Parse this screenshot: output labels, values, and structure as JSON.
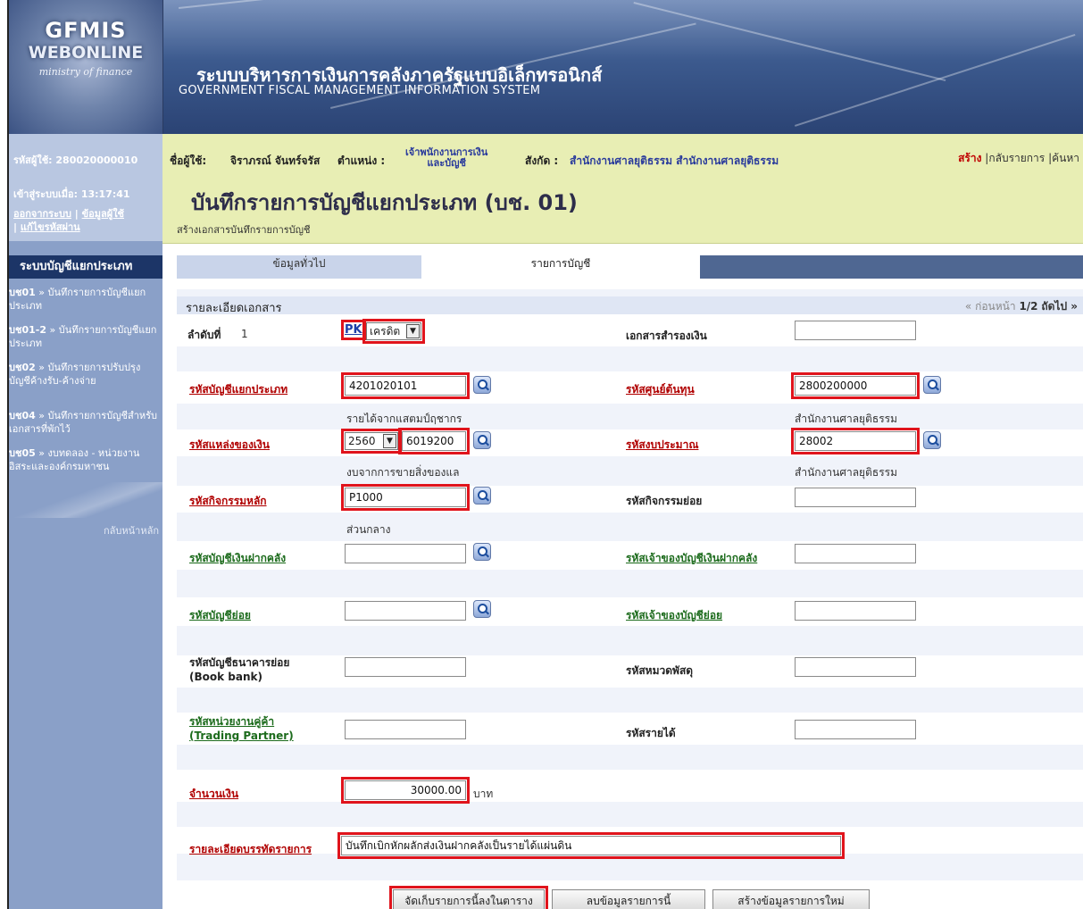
{
  "logo": {
    "line1": "GFMIS",
    "line2": "WEBONLINE",
    "line3": "ministry of finance"
  },
  "system": {
    "title_th": "ระบบบริหารการเงินการคลังภาครัฐแบบอิเล็กทรอนิกส์",
    "title_en": "GOVERNMENT FISCAL MANAGEMENT INFORMATION SYSTEM"
  },
  "sidebar": {
    "user_id_label": "รหัสผู้ใช้:",
    "user_id": "280020000010",
    "login_label": "เข้าสู่ระบบเมื่อ:",
    "login_time": "13:17:41",
    "links": [
      "ออกจากระบบ",
      "ข้อมูลผู้ใช้",
      "แก้ไขรหัสผ่าน"
    ],
    "section_title": "ระบบบัญชีแยกประเภท",
    "items": [
      {
        "code": "บช01",
        "text": "บันทึกรายการบัญชีแยกประเภท"
      },
      {
        "code": "บช01-2",
        "text": "บันทึกรายการบัญชีแยกประเภท"
      },
      {
        "code": "บช02",
        "text": "บันทึกรายการปรับปรุงบัญชีค้างรับ-ค้างจ่าย"
      },
      {
        "code": "บช04",
        "text": "บันทึกรายการบัญชีสำหรับเอกสารที่พักไว้"
      },
      {
        "code": "บช05",
        "text": "งบทดลอง - หน่วยงานอิสระและองค์กรมหาชน"
      }
    ],
    "back": "กลับหน้าหลัก"
  },
  "userbar": {
    "user_label": "ชื่อผู้ใช้:",
    "user_name": "จิราภรณ์ จันทร์จรัส",
    "position_label": "ตำแหน่ง :",
    "position_l1": "เจ้าพนักงานการเงิน",
    "position_l2": "และบัญชี",
    "affil_label": "สังกัด :",
    "affil": "สำนักงานศาลยุติธรรม สำนักงานศาลยุติธรรม",
    "actions": {
      "create": "สร้าง",
      "back": "กลับรายการ",
      "search": "ค้นหา"
    }
  },
  "page": {
    "title": "บันทึกรายการบัญชีแยกประเภท (บช. 01)",
    "subtitle": "สร้างเอกสารบันทึกรายการบัญชี"
  },
  "tabs": [
    "ข้อมูลทั่วไป",
    "รายการบัญชี"
  ],
  "form": {
    "section_title": "รายละเอียดเอกสาร",
    "pager": {
      "prev": "« ก่อนหน้า",
      "page": "1/2",
      "next": "ถัดไป »"
    },
    "seq_label": "ลำดับที่",
    "seq": "1",
    "pk": "PK",
    "posting_type": "เครดิต",
    "reserve_doc_label": "เอกสารสำรองเงิน",
    "gl_label": "รหัสบัญชีแยกประเภท",
    "gl": "4201020101",
    "gl_desc": "รายได้จากแสตมป์ฤชากร",
    "cost_center_label": "รหัสศูนย์ต้นทุน",
    "cost_center": "2800200000",
    "cost_center_desc": "สำนักงานศาลยุติธรรม",
    "fund_label": "รหัสแหล่งของเงิน",
    "fund_year": "2560",
    "fund": "6019200",
    "fund_desc": "งบจากการขายสิ่งของแล",
    "budget_label": "รหัสงบประมาณ",
    "budget": "28002",
    "budget_desc": "สำนักงานศาลยุติธรรม",
    "activity_label": "รหัสกิจกรรมหลัก",
    "activity": "P1000",
    "activity_desc": "ส่วนกลาง",
    "sub_activity_label": "รหัสกิจกรรมย่อย",
    "deposit_acct_label": "รหัสบัญชีเงินฝากคลัง",
    "deposit_owner_label": "รหัสเจ้าของบัญชีเงินฝากคลัง",
    "sub_acct_label": "รหัสบัญชีย่อย",
    "sub_acct_owner_label": "รหัสเจ้าของบัญชีย่อย",
    "bank_label_1": "รหัสบัญชีธนาคารย่อย",
    "bank_label_2": "(Book bank)",
    "inventory_label": "รหัสหมวดพัสดุ",
    "tp_label_1": "รหัสหน่วยงานคู่ค้า",
    "tp_label_2": "(Trading Partner)",
    "revenue_label": "รหัสรายได้",
    "amount_label": "จำนวนเงิน",
    "amount": "30000.00",
    "currency": "บาท",
    "line_text_label": "รายละเอียดบรรทัดรายการ",
    "line_text": "บันทึกเบิกหักผลักส่งเงินฝากคลังเป็นรายได้แผ่นดิน"
  },
  "buttons": {
    "save": "จัดเก็บรายการนี้ลงในตาราง",
    "delete": "ลบข้อมูลรายการนี้",
    "new": "สร้างข้อมูลรายการใหม่"
  }
}
